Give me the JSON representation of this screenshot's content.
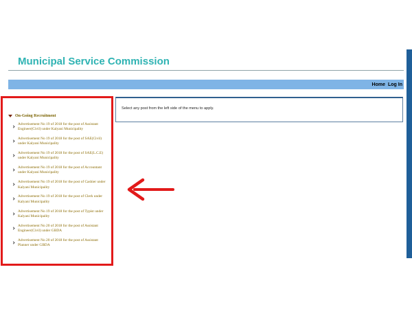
{
  "site": {
    "title": "Municipal Service Commission"
  },
  "nav": {
    "home_label": "Home",
    "login_label": "Log In"
  },
  "sidebar": {
    "section_label": "On-Going Recruitment",
    "items": [
      {
        "label": "Advertisement No 19 of 2018 for the post of Assistant Engineer(Civil) under Kalyani Municipality"
      },
      {
        "label": "Advertisement No 19 of 2018 for the post of SAE(Civil) under Kalyani Municipality"
      },
      {
        "label": "Advertisement No 19 of 2018 for the post of SAE(L.C.E) under Kalyani Municipality"
      },
      {
        "label": "Advertisement No 19 of 2018 for the post of Accountant under Kalyani Municipality"
      },
      {
        "label": "Advertisement No 19 of 2018 for the post of Cashier under Kalyani Municipality"
      },
      {
        "label": "Advertisement No 19 of 2018 for the post of Clerk under Kalyani Municipality"
      },
      {
        "label": "Advertisement No 19 of 2018 for the post of Typist under Kalyani Municipality"
      },
      {
        "label": "Advertisement No 20 of 2018 for the post of Assistant Engineer(Civil) under GBDA"
      },
      {
        "label": "Advertisement No 20 of 2018 for the post of Assistant Planner under GBDA"
      }
    ]
  },
  "content": {
    "message": "Select any post from the left side of the menu to apply."
  },
  "colors": {
    "title": "#2fb3b3",
    "nav_bar": "#7fb4e6",
    "highlight": "#e21a1a",
    "arrow": "#e21a1a",
    "menu_text": "#8a6a00"
  },
  "icons": {
    "section_toggle": "triangle-down-icon",
    "item_marker": "chevron-right-icon",
    "annotation": "arrow-left-icon"
  }
}
